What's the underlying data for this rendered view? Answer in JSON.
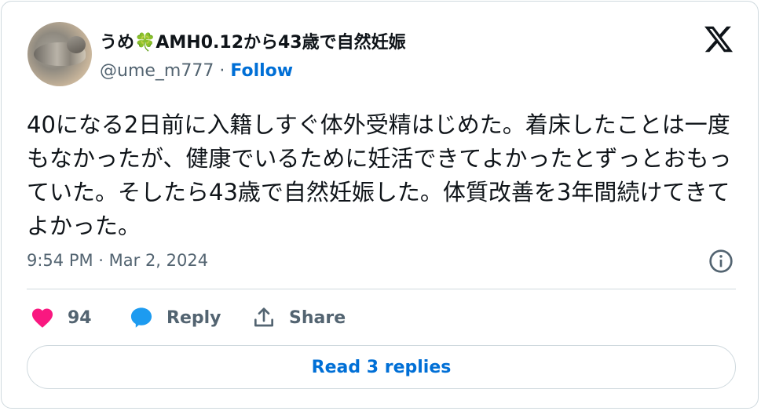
{
  "author": {
    "display_name": "うめ🍀AMH0.12から43歳で自然妊娠",
    "handle": "@ume_m777",
    "separator": "·",
    "follow_label": "Follow"
  },
  "tweet": {
    "text": "40になる2日前に入籍しすぐ体外受精はじめた。着床したことは一度もなかったが、健康でいるために妊活できてよかったとずっとおもっていた。そしたら43歳で自然妊娠した。体質改善を3年間続けてきてよかった。",
    "timestamp": "9:54 PM · Mar 2, 2024"
  },
  "actions": {
    "like_count": "94",
    "reply_label": "Reply",
    "share_label": "Share",
    "read_replies_label": "Read 3 replies"
  },
  "icons": {
    "brand": "x-logo-icon",
    "info": "info-icon",
    "like": "heart-icon",
    "reply": "speech-bubble-icon",
    "share": "share-upload-icon"
  },
  "colors": {
    "link": "#006fd6",
    "like": "#f91880",
    "reply": "#1d9bf0",
    "muted": "#536471",
    "border": "#cfd9de"
  }
}
